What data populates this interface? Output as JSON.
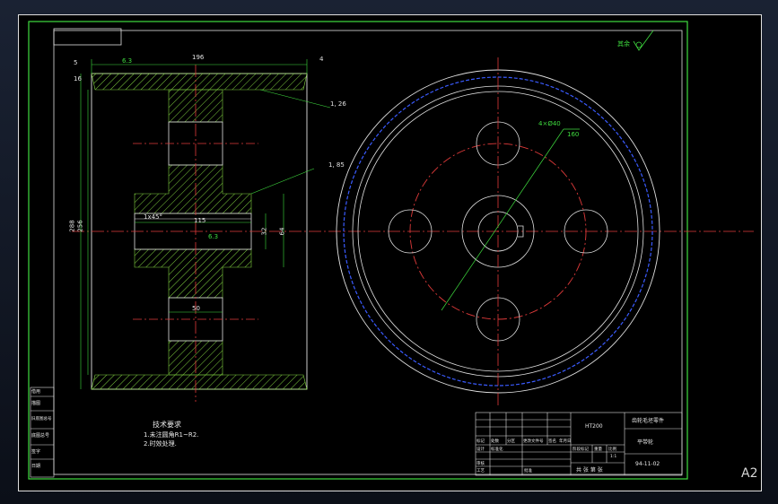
{
  "viewport": {
    "sheet_size": "A2"
  },
  "dims": {
    "width_196": "196",
    "gap_5": "5",
    "gap_4": "4",
    "rough_63_top": "6.3",
    "dim_16": "16",
    "dim_288": "288",
    "dim_256": "256",
    "angle_1_26": "1, 26",
    "angle_1_85": "1, 85",
    "chamfer": "1x45°",
    "dim_115": "115",
    "rough_63_mid": "6.3",
    "dim_32": "32",
    "dim_64": "64",
    "dim_50": "50",
    "holes": "4×Ø40",
    "pcd_160": "160"
  },
  "tech": {
    "title": "技术要求",
    "item1": "1.未注圆角R1~R2.",
    "item2": "2.时效处理."
  },
  "roughness_mark": "其余",
  "side_cells": [
    "借用",
    "描图",
    "旧底图总号",
    "底图总号",
    "签字",
    "日期"
  ],
  "title_block": {
    "material": "HT200",
    "drawing_name": "齿轮毛坯零件",
    "scale_label": "平带轮",
    "drawing_no": "94-11-02",
    "row_labels": [
      "标记",
      "处数",
      "分区",
      "更改文件号",
      "签名",
      "年月日"
    ],
    "design": "设计",
    "standard": "标准化",
    "review": "审核",
    "process": "工艺",
    "approve": "批准",
    "stage": "阶段标记",
    "weight": "重量",
    "ratio": "比例",
    "ratio_val": "1:1",
    "sheets": "共 张 第 张"
  }
}
